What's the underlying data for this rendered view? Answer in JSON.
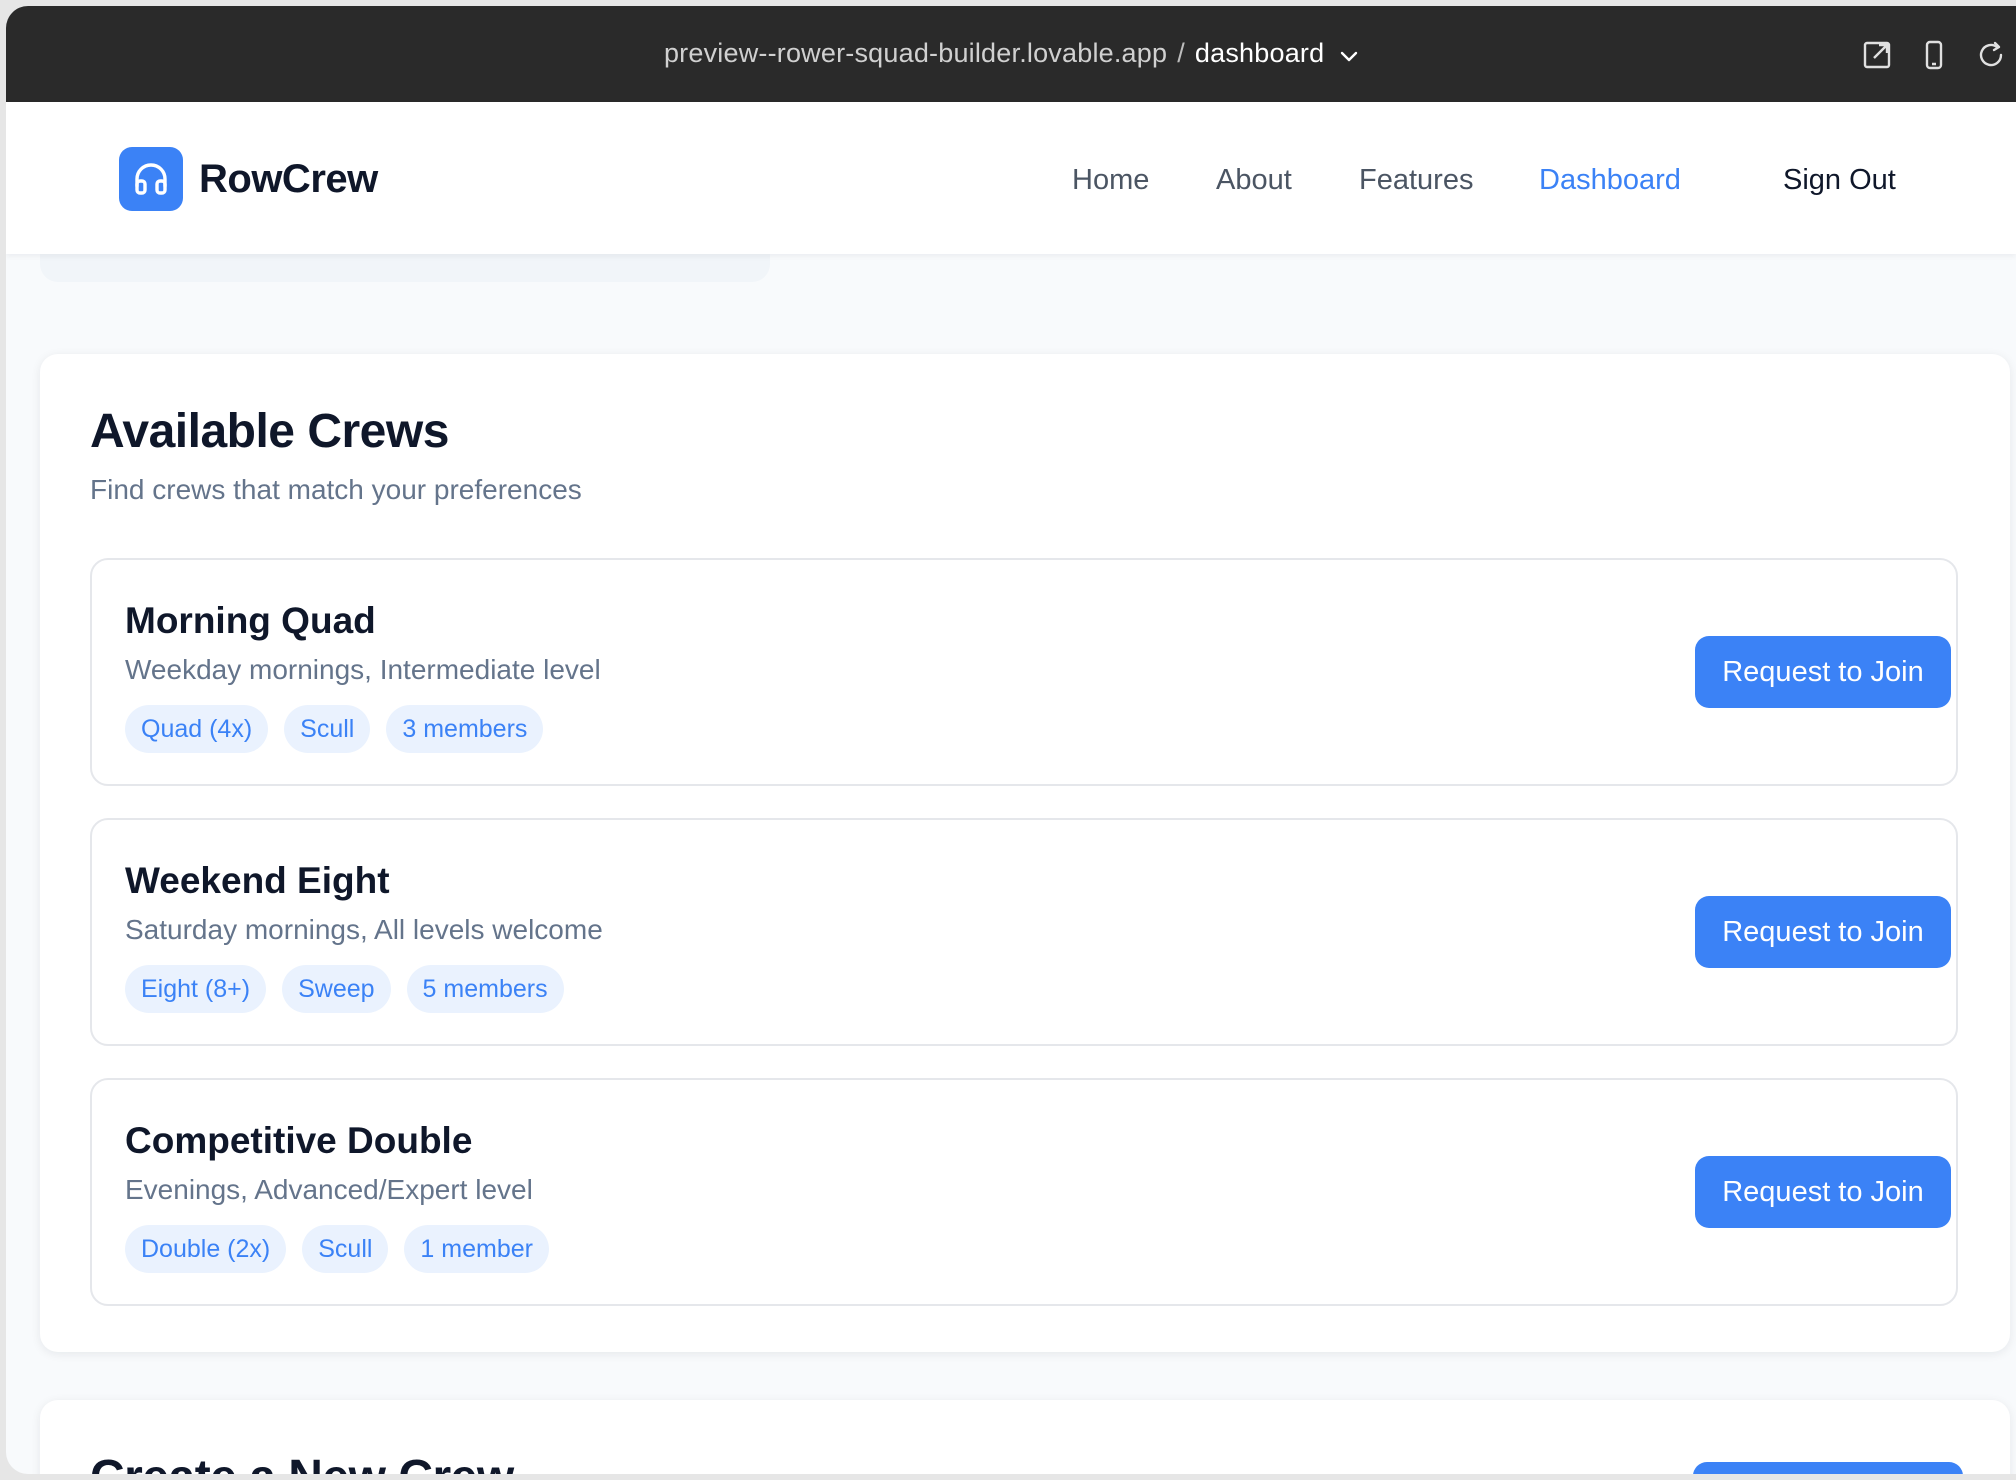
{
  "browser": {
    "host": "preview--rower-squad-builder.lovable.app",
    "separator": "/",
    "route": "dashboard"
  },
  "nav": {
    "brand": "RowCrew",
    "links": [
      "Home",
      "About",
      "Features",
      "Dashboard"
    ],
    "active": "Dashboard",
    "sign_out": "Sign Out"
  },
  "crews_section": {
    "title": "Available Crews",
    "subtitle": "Find crews that match your preferences",
    "crews": [
      {
        "name": "Morning Quad",
        "description": "Weekday mornings, Intermediate level",
        "tags": [
          "Quad (4x)",
          "Scull",
          "3 members"
        ],
        "action": "Request to Join"
      },
      {
        "name": "Weekend Eight",
        "description": "Saturday mornings, All levels welcome",
        "tags": [
          "Eight (8+)",
          "Sweep",
          "5 members"
        ],
        "action": "Request to Join"
      },
      {
        "name": "Competitive Double",
        "description": "Evenings, Advanced/Expert level",
        "tags": [
          "Double (2x)",
          "Scull",
          "1 member"
        ],
        "action": "Request to Join"
      }
    ]
  },
  "create_section": {
    "title": "Create a New Crew"
  },
  "colors": {
    "accent": "#3b82f6",
    "tag_bg": "#eaf2fe",
    "topbar": "#2a2a2a"
  }
}
